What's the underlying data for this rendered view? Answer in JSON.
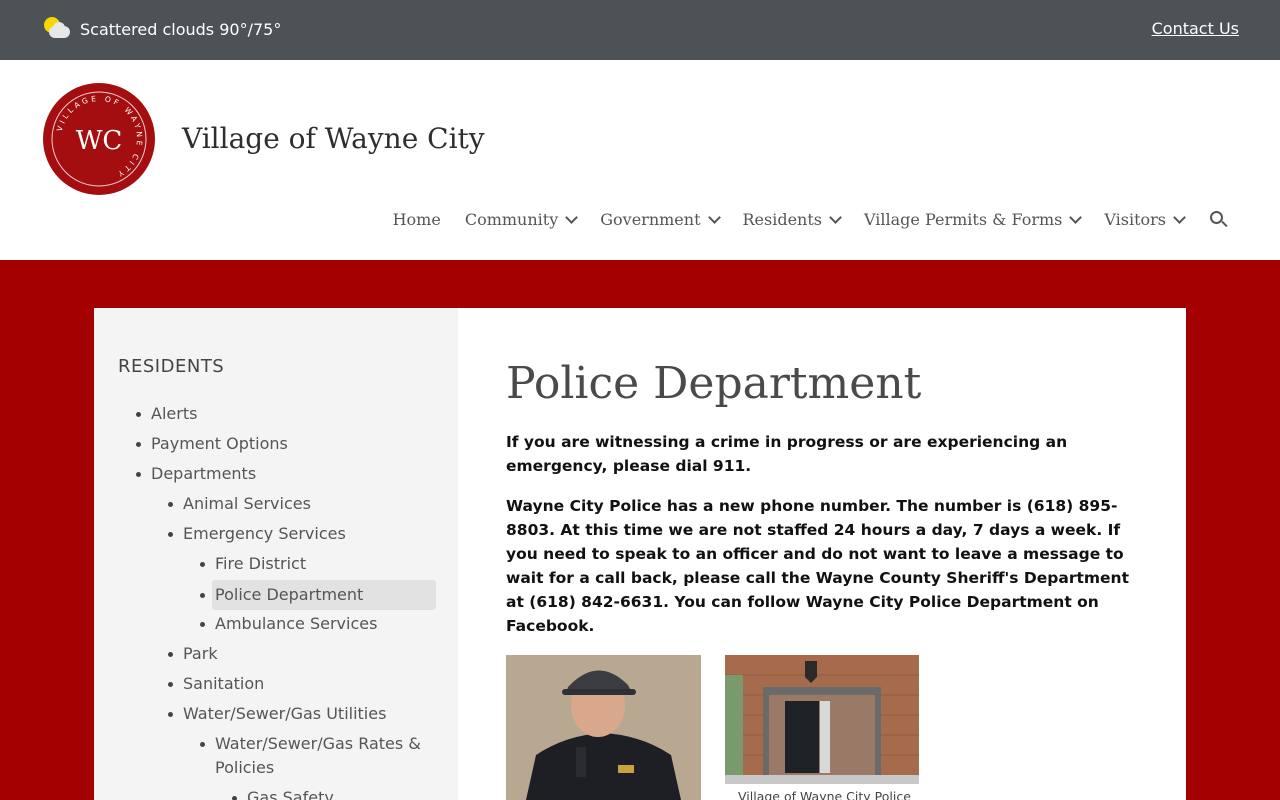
{
  "topbar": {
    "weather": "Scattered clouds 90°/75°",
    "weather_icon": "partly-cloudy-icon",
    "contact": "Contact Us"
  },
  "header": {
    "site_title": "Village of Wayne City",
    "seal": {
      "initials": "WC",
      "ring_text": "VILLAGE OF WAYNE CITY",
      "color": "#a50e10"
    }
  },
  "nav": {
    "items": [
      {
        "label": "Home",
        "has_menu": false
      },
      {
        "label": "Community",
        "has_menu": true
      },
      {
        "label": "Government",
        "has_menu": true
      },
      {
        "label": "Residents",
        "has_menu": true
      },
      {
        "label": "Village Permits & Forms",
        "has_menu": true
      },
      {
        "label": "Visitors",
        "has_menu": true
      }
    ],
    "search_icon": "search-icon"
  },
  "sidebar": {
    "heading": "RESIDENTS",
    "items": [
      {
        "label": "Alerts"
      },
      {
        "label": "Payment Options"
      },
      {
        "label": "Departments"
      },
      {
        "label": "Animal Services"
      },
      {
        "label": "Emergency Services"
      },
      {
        "label": "Fire District"
      },
      {
        "label": "Police Department",
        "active": true
      },
      {
        "label": "Ambulance Services"
      },
      {
        "label": "Park"
      },
      {
        "label": "Sanitation"
      },
      {
        "label": "Water/Sewer/Gas Utilities"
      },
      {
        "label": "Water/Sewer/Gas Rates & Policies"
      },
      {
        "label": "Gas Safety"
      }
    ]
  },
  "main": {
    "title": "Police Department",
    "p1": "If you are witnessing a crime in progress or are experiencing an emergency, please dial 911.",
    "p2": "Wayne City Police has a new phone number. The number is (618) 895-8803.  At this time we are not staffed 24 hours a day, 7 days a week.  If you need to speak to an officer and do not want to leave a message to wait for a call back, please call the Wayne County Sheriff's Department at (618) 842-6631.  You can follow Wayne City Police Department on Facebook.",
    "photo2_caption": "Village of Wayne City Police"
  },
  "colors": {
    "topbar": "#4d5257",
    "brand_red": "#a50000",
    "sidebar_bg": "#f4f4f4"
  }
}
